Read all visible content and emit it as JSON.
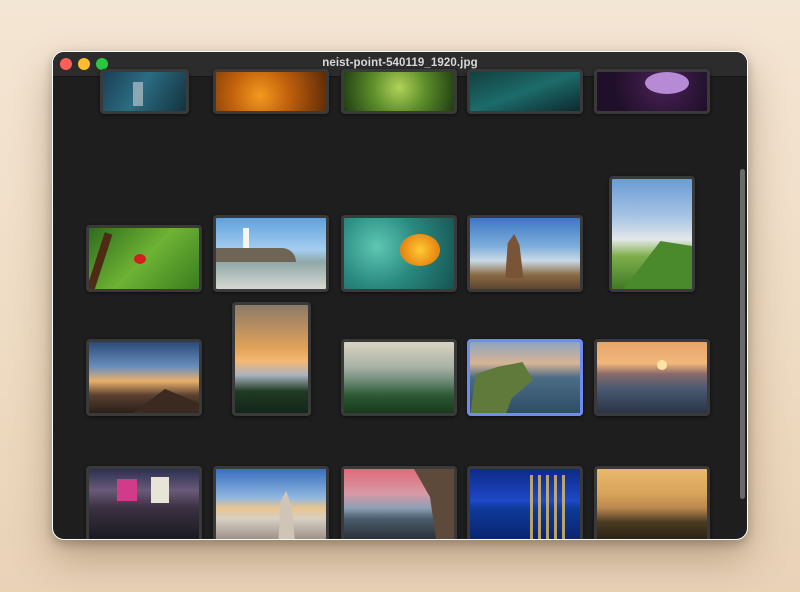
{
  "window": {
    "title": "neist-point-540119_1920.jpg"
  },
  "thumbnails": [
    {
      "name": "photo-boats-harbor",
      "row": 0,
      "col": 0,
      "selected": false
    },
    {
      "name": "photo-orange-flowers",
      "row": 0,
      "col": 1,
      "selected": false
    },
    {
      "name": "photo-dew-grass",
      "row": 0,
      "col": 2,
      "selected": false
    },
    {
      "name": "photo-teal-water",
      "row": 0,
      "col": 3,
      "selected": false
    },
    {
      "name": "photo-purple-flower",
      "row": 0,
      "col": 4,
      "selected": false
    },
    {
      "name": "photo-ladybug-leaf",
      "row": 1,
      "col": 0,
      "selected": false
    },
    {
      "name": "photo-lighthouse-coast",
      "row": 1,
      "col": 1,
      "selected": false
    },
    {
      "name": "photo-orange-blossom",
      "row": 1,
      "col": 2,
      "selected": false
    },
    {
      "name": "photo-rock-spire",
      "row": 1,
      "col": 3,
      "selected": false
    },
    {
      "name": "photo-green-ridge",
      "row": 1,
      "col": 4,
      "selected": false
    },
    {
      "name": "photo-mountain-sunset-clouds",
      "row": 2,
      "col": 0,
      "selected": false
    },
    {
      "name": "photo-valley-sunrise",
      "row": 2,
      "col": 1,
      "selected": false
    },
    {
      "name": "photo-forest-valley",
      "row": 2,
      "col": 2,
      "selected": false
    },
    {
      "name": "photo-neist-point",
      "row": 2,
      "col": 3,
      "selected": true
    },
    {
      "name": "photo-ocean-sunset",
      "row": 2,
      "col": 4,
      "selected": false
    },
    {
      "name": "photo-city-crowd-night",
      "row": 3,
      "col": 0,
      "selected": false
    },
    {
      "name": "photo-stone-cairn",
      "row": 3,
      "col": 1,
      "selected": false
    },
    {
      "name": "photo-sea-cave",
      "row": 3,
      "col": 2,
      "selected": false
    },
    {
      "name": "photo-city-reflection",
      "row": 3,
      "col": 3,
      "selected": false
    },
    {
      "name": "photo-misty-hills",
      "row": 3,
      "col": 4,
      "selected": false
    }
  ],
  "colors": {
    "selection": "#6f8df0",
    "window_bg": "#1e1e1e",
    "titlebar_bg": "#2c2c2c"
  }
}
